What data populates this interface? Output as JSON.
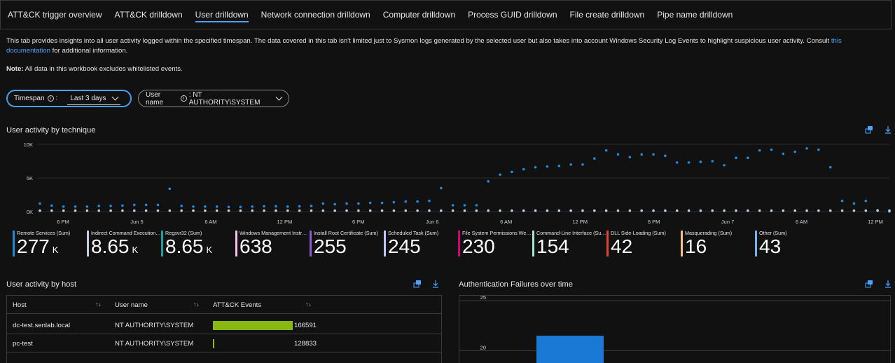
{
  "tabs": [
    {
      "label": "ATT&CK trigger overview",
      "active": false
    },
    {
      "label": "ATT&CK drilldown",
      "active": false
    },
    {
      "label": "User drilldown",
      "active": true
    },
    {
      "label": "Network connection drilldown",
      "active": false
    },
    {
      "label": "Computer drilldown",
      "active": false
    },
    {
      "label": "Process GUID drilldown",
      "active": false
    },
    {
      "label": "File create drilldown",
      "active": false
    },
    {
      "label": "Pipe name drilldown",
      "active": false
    }
  ],
  "description": {
    "text": "This tab provides insights into all user activity logged within the specified timespan. The data covered in this tab isn't limited just to Sysmon logs generated by the selected user but also takes into account Windows Security Log Events to highlight suspicious user activity. Consult ",
    "link_1": "this",
    "link_2": "documentation",
    "tail": " for additional information."
  },
  "note": {
    "label": "Note:",
    "text": " All data in this workbook excludes whitelisted events."
  },
  "params": {
    "timespan_label": "Timespan",
    "timespan_value": "Last 3 days",
    "username_label": "User name",
    "username_value": ": NT AUTHORITY\\SYSTEM"
  },
  "user_activity": {
    "title": "User activity by technique",
    "icons": {
      "pin": "pin-dashboard-icon",
      "download": "download-icon"
    }
  },
  "chart_data": [
    {
      "type": "scatter",
      "title": "User activity by technique",
      "y_ticks": [
        "10K",
        "5K",
        "0K"
      ],
      "ylim": [
        0,
        10000
      ],
      "x_ticks": [
        "6 PM",
        "Jun 5",
        "6 AM",
        "12 PM",
        "6 PM",
        "Jun 6",
        "6 AM",
        "12 PM",
        "6 PM",
        "Jun 7",
        "6 AM",
        "12 PM"
      ],
      "x": [
        0,
        1,
        2,
        3,
        4,
        5,
        6,
        7,
        8,
        9,
        10,
        11,
        12,
        13,
        14,
        15,
        16,
        17,
        18,
        19,
        20,
        21,
        22,
        23,
        24,
        25,
        26,
        27,
        28,
        29,
        30,
        31,
        32,
        33,
        34,
        35,
        36,
        37,
        38,
        39,
        40,
        41,
        42,
        43,
        44,
        45,
        46,
        47,
        48,
        49,
        50,
        51,
        52,
        53,
        54,
        55,
        56,
        57,
        58,
        59,
        60,
        61,
        62,
        63,
        64,
        65,
        66,
        67,
        68,
        69,
        70,
        71,
        72
      ],
      "series": [
        {
          "color": "#1f8bdc",
          "values": [
            1200,
            900,
            750,
            750,
            750,
            850,
            850,
            900,
            1000,
            1000,
            1000,
            3400,
            850,
            750,
            750,
            750,
            700,
            700,
            750,
            800,
            800,
            750,
            800,
            850,
            1200,
            1100,
            1200,
            1200,
            1300,
            1300,
            1400,
            1500,
            1500,
            1600,
            3500,
            950,
            950,
            950,
            4500,
            5500,
            5900,
            6300,
            6600,
            6700,
            6800,
            7000,
            7000,
            7900,
            9100,
            8500,
            8100,
            8500,
            8500,
            8300,
            7300,
            7300,
            7400,
            7500,
            6900,
            8000,
            8000,
            9100,
            9200,
            8600,
            8900,
            9400,
            9200,
            6600,
            1600,
            1200,
            1600,
            200,
            0
          ]
        },
        {
          "color": "#c5d0dc",
          "values": [
            150,
            150,
            150,
            150,
            150,
            150,
            150,
            150,
            150,
            150,
            150,
            150,
            150,
            150,
            150,
            150,
            150,
            150,
            150,
            150,
            150,
            150,
            150,
            150,
            150,
            150,
            150,
            150,
            150,
            150,
            150,
            150,
            150,
            150,
            150,
            150,
            150,
            150,
            150,
            150,
            150,
            150,
            150,
            150,
            150,
            150,
            150,
            150,
            150,
            150,
            150,
            150,
            150,
            150,
            150,
            150,
            150,
            150,
            150,
            150,
            150,
            150,
            150,
            150,
            150,
            150,
            150,
            150,
            150,
            150,
            150,
            150,
            150
          ]
        }
      ],
      "kpis": [
        {
          "label": "Remote Services (Sum)",
          "value": "277",
          "unit": "K",
          "color": "#1f8bdc"
        },
        {
          "label": "Indirect Command Execution (Sum)",
          "value": "8.65",
          "unit": "K",
          "color": "#c5d0dc"
        },
        {
          "label": "Regsvr32 (Sum)",
          "value": "8.65",
          "unit": "K",
          "color": "#12a0a0"
        },
        {
          "label": "Windows Management Instrumentation (Sum)",
          "value": "638",
          "unit": "",
          "color": "#f7c1f0"
        },
        {
          "label": "Install Root Certificate (Sum)",
          "value": "255",
          "unit": "",
          "color": "#8c5ad0"
        },
        {
          "label": "Scheduled Task (Sum)",
          "value": "245",
          "unit": "",
          "color": "#b9c7ff"
        },
        {
          "label": "File System Permissions Weakness (Sum)",
          "value": "230",
          "unit": "",
          "color": "#d6007a"
        },
        {
          "label": "Command-Line Interface (Sum)",
          "value": "154",
          "unit": "",
          "color": "#a8e6d0"
        },
        {
          "label": "DLL Side-Loading (Sum)",
          "value": "42",
          "unit": "",
          "color": "#e0452f"
        },
        {
          "label": "Masquerading (Sum)",
          "value": "16",
          "unit": "",
          "color": "#f5c28c"
        },
        {
          "label": "Other (Sum)",
          "value": "43",
          "unit": "",
          "color": "#6fb4f0"
        }
      ]
    },
    {
      "type": "bar",
      "title": "Authentication Failures over time",
      "y_ticks": [
        "25",
        "20"
      ],
      "values": [
        21.5
      ],
      "ylim": [
        15,
        25
      ]
    }
  ],
  "host_grid": {
    "title": "User activity by host",
    "columns": [
      "Host",
      "User name",
      "ATT&CK Events"
    ],
    "rows": [
      {
        "host": "dc-test.senlab.local",
        "user": "NT AUTHORITY\\SYSTEM",
        "events": "166591",
        "fraction": 1.0
      },
      {
        "host": "pc-test",
        "user": "NT AUTHORITY\\SYSTEM",
        "events": "128833",
        "fraction": 0.02
      }
    ]
  },
  "auth": {
    "title": "Authentication Failures over time"
  }
}
